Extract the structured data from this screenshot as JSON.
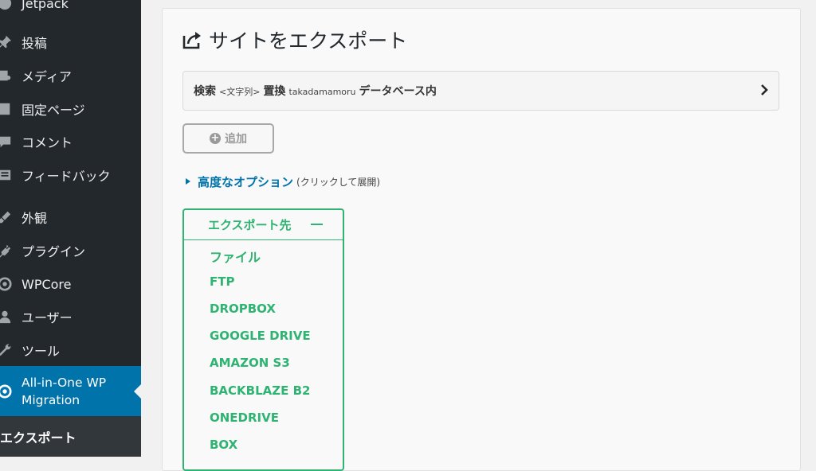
{
  "sidebar": {
    "items": [
      {
        "label": "Jetpack",
        "icon": "jetpack-icon"
      },
      {
        "label": "投稿",
        "icon": "pin-icon"
      },
      {
        "label": "メディア",
        "icon": "media-icon"
      },
      {
        "label": "固定ページ",
        "icon": "page-icon"
      },
      {
        "label": "コメント",
        "icon": "comment-icon"
      },
      {
        "label": "フィードバック",
        "icon": "feedback-icon"
      },
      {
        "label": "外観",
        "icon": "brush-icon"
      },
      {
        "label": "プラグイン",
        "icon": "plugin-icon"
      },
      {
        "label": "WPCore",
        "icon": "wpcore-icon"
      },
      {
        "label": "ユーザー",
        "icon": "user-icon"
      },
      {
        "label": "ツール",
        "icon": "wrench-icon"
      }
    ],
    "active": {
      "label_line1": "All-in-One WP",
      "label_line2": "Migration",
      "icon": "ai1wm-icon"
    },
    "submenu": {
      "label": "エクスポート"
    },
    "colors": {
      "bg": "#23282d",
      "active": "#0073aa"
    }
  },
  "main": {
    "title": "サイトをエクスポート",
    "find_replace": {
      "search_label": "検索",
      "search_value": "<文字列>",
      "replace_label": "置換",
      "replace_value": "takadamamoru",
      "scope": "データベース内"
    },
    "add_button": "追加",
    "advanced": {
      "link": "高度なオプション",
      "hint": "(クリックして展開)"
    },
    "export_to": {
      "header": "エクスポート先",
      "items": [
        "ファイル",
        "FTP",
        "DROPBOX",
        "GOOGLE DRIVE",
        "AMAZON S3",
        "BACKBLAZE B2",
        "ONEDRIVE",
        "BOX"
      ],
      "color": "#2eb372"
    }
  }
}
